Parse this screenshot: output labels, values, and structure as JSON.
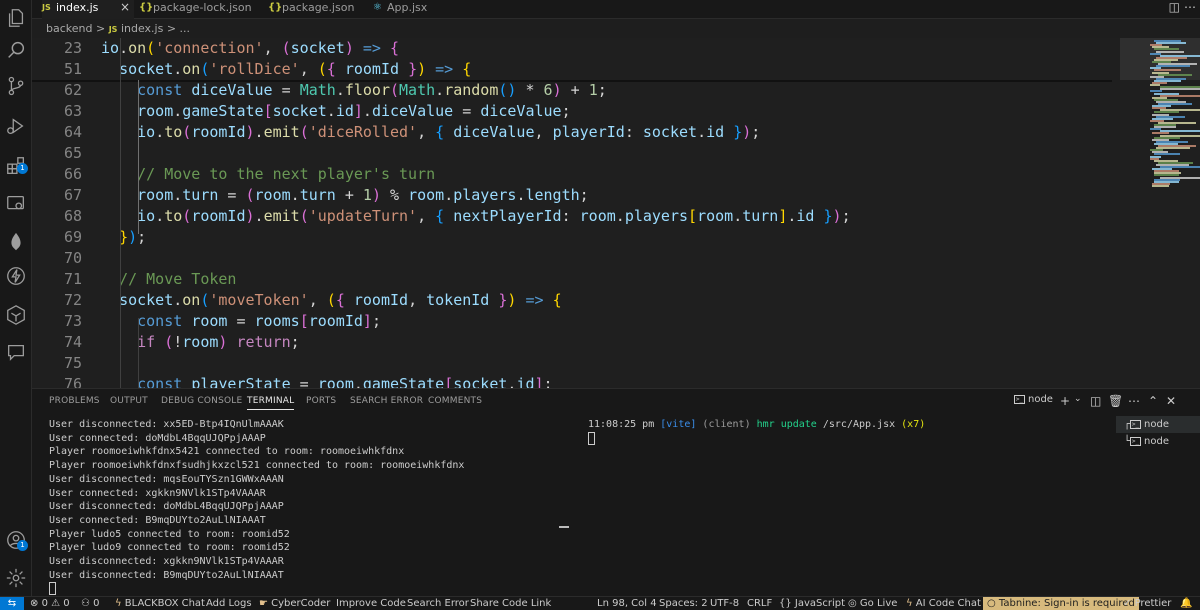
{
  "tabs": [
    {
      "icon": "JS",
      "label": "index.js",
      "active": true
    },
    {
      "icon": "{}",
      "label": "package-lock.json"
    },
    {
      "icon": "{}",
      "label": "package.json"
    },
    {
      "icon": "⚛",
      "label": "App.jsx"
    }
  ],
  "tab_close": "×",
  "breadcrumb": {
    "folder": "backend",
    "sep": ">",
    "file_icon": "JS",
    "file": "index.js",
    "tail": "> ..."
  },
  "editor": {
    "line_numbers": [
      "23",
      "51",
      "62",
      "63",
      "64",
      "65",
      "66",
      "67",
      "68",
      "69",
      "70",
      "71",
      "72",
      "73",
      "74",
      "75",
      "76"
    ],
    "lines": [
      [
        [
          "t-var",
          "io"
        ],
        [
          "t-op",
          "."
        ],
        [
          "t-fn",
          "on"
        ],
        [
          "t-b1",
          "("
        ],
        [
          "t-str",
          "'connection'"
        ],
        [
          "t-op",
          ", "
        ],
        [
          "t-b2",
          "("
        ],
        [
          "t-var",
          "socket"
        ],
        [
          "t-b2",
          ")"
        ],
        [
          "t-op",
          " "
        ],
        [
          "t-kw",
          "=>"
        ],
        [
          "t-op",
          " "
        ],
        [
          "t-b2",
          "{"
        ]
      ],
      [
        [
          "t-op",
          "  "
        ],
        [
          "t-var",
          "socket"
        ],
        [
          "t-op",
          "."
        ],
        [
          "t-fn",
          "on"
        ],
        [
          "t-b3",
          "("
        ],
        [
          "t-str",
          "'rollDice'"
        ],
        [
          "t-op",
          ", "
        ],
        [
          "t-b1",
          "("
        ],
        [
          "t-b2",
          "{"
        ],
        [
          "t-op",
          " "
        ],
        [
          "t-var",
          "roomId"
        ],
        [
          "t-op",
          " "
        ],
        [
          "t-b2",
          "}"
        ],
        [
          "t-b1",
          ")"
        ],
        [
          "t-op",
          " "
        ],
        [
          "t-kw",
          "=>"
        ],
        [
          "t-op",
          " "
        ],
        [
          "t-b1",
          "{"
        ]
      ],
      [
        [
          "t-op",
          "    "
        ],
        [
          "t-kw",
          "const"
        ],
        [
          "t-op",
          " "
        ],
        [
          "t-var",
          "diceValue"
        ],
        [
          "t-op",
          " = "
        ],
        [
          "t-cls",
          "Math"
        ],
        [
          "t-op",
          "."
        ],
        [
          "t-fn",
          "floor"
        ],
        [
          "t-b2",
          "("
        ],
        [
          "t-cls",
          "Math"
        ],
        [
          "t-op",
          "."
        ],
        [
          "t-fn",
          "random"
        ],
        [
          "t-b3",
          "()"
        ],
        [
          "t-op",
          " * "
        ],
        [
          "t-num",
          "6"
        ],
        [
          "t-b2",
          ")"
        ],
        [
          "t-op",
          " + "
        ],
        [
          "t-num",
          "1"
        ],
        [
          "t-op",
          ";"
        ]
      ],
      [
        [
          "t-op",
          "    "
        ],
        [
          "t-var",
          "room"
        ],
        [
          "t-op",
          "."
        ],
        [
          "t-var",
          "gameState"
        ],
        [
          "t-b2",
          "["
        ],
        [
          "t-var",
          "socket"
        ],
        [
          "t-op",
          "."
        ],
        [
          "t-var",
          "id"
        ],
        [
          "t-b2",
          "]"
        ],
        [
          "t-op",
          "."
        ],
        [
          "t-var",
          "diceValue"
        ],
        [
          "t-op",
          " = "
        ],
        [
          "t-var",
          "diceValue"
        ],
        [
          "t-op",
          ";"
        ]
      ],
      [
        [
          "t-op",
          "    "
        ],
        [
          "t-var",
          "io"
        ],
        [
          "t-op",
          "."
        ],
        [
          "t-fn",
          "to"
        ],
        [
          "t-b2",
          "("
        ],
        [
          "t-var",
          "roomId"
        ],
        [
          "t-b2",
          ")"
        ],
        [
          "t-op",
          "."
        ],
        [
          "t-fn",
          "emit"
        ],
        [
          "t-b2",
          "("
        ],
        [
          "t-str",
          "'diceRolled'"
        ],
        [
          "t-op",
          ", "
        ],
        [
          "t-b3",
          "{"
        ],
        [
          "t-op",
          " "
        ],
        [
          "t-var",
          "diceValue"
        ],
        [
          "t-op",
          ", "
        ],
        [
          "t-var",
          "playerId"
        ],
        [
          "t-op",
          ": "
        ],
        [
          "t-var",
          "socket"
        ],
        [
          "t-op",
          "."
        ],
        [
          "t-var",
          "id"
        ],
        [
          "t-op",
          " "
        ],
        [
          "t-b3",
          "}"
        ],
        [
          "t-b2",
          ")"
        ],
        [
          "t-op",
          ";"
        ]
      ],
      [],
      [
        [
          "t-op",
          "    "
        ],
        [
          "t-cm",
          "// Move to the next player's turn"
        ]
      ],
      [
        [
          "t-op",
          "    "
        ],
        [
          "t-var",
          "room"
        ],
        [
          "t-op",
          "."
        ],
        [
          "t-var",
          "turn"
        ],
        [
          "t-op",
          " = "
        ],
        [
          "t-b2",
          "("
        ],
        [
          "t-var",
          "room"
        ],
        [
          "t-op",
          "."
        ],
        [
          "t-var",
          "turn"
        ],
        [
          "t-op",
          " + "
        ],
        [
          "t-num",
          "1"
        ],
        [
          "t-b2",
          ")"
        ],
        [
          "t-op",
          " % "
        ],
        [
          "t-var",
          "room"
        ],
        [
          "t-op",
          "."
        ],
        [
          "t-var",
          "players"
        ],
        [
          "t-op",
          "."
        ],
        [
          "t-var",
          "length"
        ],
        [
          "t-op",
          ";"
        ]
      ],
      [
        [
          "t-op",
          "    "
        ],
        [
          "t-var",
          "io"
        ],
        [
          "t-op",
          "."
        ],
        [
          "t-fn",
          "to"
        ],
        [
          "t-b2",
          "("
        ],
        [
          "t-var",
          "roomId"
        ],
        [
          "t-b2",
          ")"
        ],
        [
          "t-op",
          "."
        ],
        [
          "t-fn",
          "emit"
        ],
        [
          "t-b2",
          "("
        ],
        [
          "t-str",
          "'updateTurn'"
        ],
        [
          "t-op",
          ", "
        ],
        [
          "t-b3",
          "{"
        ],
        [
          "t-op",
          " "
        ],
        [
          "t-var",
          "nextPlayerId"
        ],
        [
          "t-op",
          ": "
        ],
        [
          "t-var",
          "room"
        ],
        [
          "t-op",
          "."
        ],
        [
          "t-var",
          "players"
        ],
        [
          "t-b1",
          "["
        ],
        [
          "t-var",
          "room"
        ],
        [
          "t-op",
          "."
        ],
        [
          "t-var",
          "turn"
        ],
        [
          "t-b1",
          "]"
        ],
        [
          "t-op",
          "."
        ],
        [
          "t-var",
          "id"
        ],
        [
          "t-op",
          " "
        ],
        [
          "t-b3",
          "}"
        ],
        [
          "t-b2",
          ")"
        ],
        [
          "t-op",
          ";"
        ]
      ],
      [
        [
          "t-op",
          "  "
        ],
        [
          "t-b1",
          "}"
        ],
        [
          "t-b3",
          ")"
        ],
        [
          "t-op",
          ";"
        ]
      ],
      [],
      [
        [
          "t-op",
          "  "
        ],
        [
          "t-cm",
          "// Move Token"
        ]
      ],
      [
        [
          "t-op",
          "  "
        ],
        [
          "t-var",
          "socket"
        ],
        [
          "t-op",
          "."
        ],
        [
          "t-fn",
          "on"
        ],
        [
          "t-b3",
          "("
        ],
        [
          "t-str",
          "'moveToken'"
        ],
        [
          "t-op",
          ", "
        ],
        [
          "t-b1",
          "("
        ],
        [
          "t-b2",
          "{"
        ],
        [
          "t-op",
          " "
        ],
        [
          "t-var",
          "roomId"
        ],
        [
          "t-op",
          ", "
        ],
        [
          "t-var",
          "tokenId"
        ],
        [
          "t-op",
          " "
        ],
        [
          "t-b2",
          "}"
        ],
        [
          "t-b1",
          ")"
        ],
        [
          "t-op",
          " "
        ],
        [
          "t-kw",
          "=>"
        ],
        [
          "t-op",
          " "
        ],
        [
          "t-b1",
          "{"
        ]
      ],
      [
        [
          "t-op",
          "    "
        ],
        [
          "t-kw",
          "const"
        ],
        [
          "t-op",
          " "
        ],
        [
          "t-var",
          "room"
        ],
        [
          "t-op",
          " = "
        ],
        [
          "t-var",
          "rooms"
        ],
        [
          "t-b2",
          "["
        ],
        [
          "t-var",
          "roomId"
        ],
        [
          "t-b2",
          "]"
        ],
        [
          "t-op",
          ";"
        ]
      ],
      [
        [
          "t-op",
          "    "
        ],
        [
          "t-ctl",
          "if"
        ],
        [
          "t-op",
          " "
        ],
        [
          "t-b2",
          "("
        ],
        [
          "t-op",
          "!"
        ],
        [
          "t-var",
          "room"
        ],
        [
          "t-b2",
          ")"
        ],
        [
          "t-op",
          " "
        ],
        [
          "t-ctl",
          "return"
        ],
        [
          "t-op",
          ";"
        ]
      ],
      [],
      [
        [
          "t-op",
          "    "
        ],
        [
          "t-kw",
          "const"
        ],
        [
          "t-op",
          " "
        ],
        [
          "t-var",
          "playerState"
        ],
        [
          "t-op",
          " = "
        ],
        [
          "t-var",
          "room"
        ],
        [
          "t-op",
          "."
        ],
        [
          "t-var",
          "gameState"
        ],
        [
          "t-b2",
          "["
        ],
        [
          "t-var",
          "socket"
        ],
        [
          "t-op",
          "."
        ],
        [
          "t-var",
          "id"
        ],
        [
          "t-b2",
          "]"
        ],
        [
          "t-op",
          ";"
        ]
      ]
    ]
  },
  "panel": {
    "tabs": [
      "PROBLEMS",
      "OUTPUT",
      "DEBUG CONSOLE",
      "TERMINAL",
      "PORTS",
      "SEARCH ERROR",
      "COMMENTS"
    ],
    "active_tab": "TERMINAL",
    "terminal_name": "node",
    "terminal_left": [
      "User disconnected: xx5ED-Btp4IQnUlmAAAK",
      "User connected: doMdbL4BqqUJQPpjAAAP",
      "Player roomoeiwhkfdnx5421 connected to room: roomoeiwhkfdnx",
      "Player roomoeiwhkfdnxfsudhjkxzcl521 connected to room: roomoeiwhkfdnx",
      "User disconnected: mqsEouTYSzn1GWWxAAAN",
      "User connected: xgkkn9NVlk1STp4VAAAR",
      "User disconnected: doMdbL4BqqUJQPpjAAAP",
      "User connected: B9mqDUYto2AuLlNIAAAT",
      "Player ludo5 connected to room: roomid52",
      "Player ludo9 connected to room: roomid52",
      "User disconnected: xgkkn9NVlk1STp4VAAAR",
      "User disconnected: B9mqDUYto2AuLlNIAAAT"
    ],
    "terminal_right": {
      "time": "11:08:25 pm",
      "tag": "[vite]",
      "client": "(client)",
      "msg": "hmr update",
      "path": "/src/App.jsx",
      "count": "(x7)"
    },
    "terminal_list": [
      "node",
      "node"
    ]
  },
  "status": {
    "errors": "0",
    "warnings": "0",
    "ports": "0",
    "blackbox": "BLACKBOX Chat",
    "add_logs": "Add Logs",
    "cybercoder": "CyberCoder",
    "improve": "Improve Code",
    "search_error": "Search Error",
    "share": "Share Code Link",
    "position": "Ln 98, Col 4",
    "spaces": "Spaces: 2",
    "encoding": "UTF-8",
    "eol": "CRLF",
    "language": "JavaScript",
    "golive": "Go Live",
    "aichat": "AI Code Chat",
    "tabnine": "Tabnine: Sign-in is required",
    "prettier": "Prettier"
  },
  "colors": {
    "accent": "#0078d4",
    "tabnine_bg": "#d7ba7d"
  },
  "icons": [
    "explorer-icon",
    "search-icon",
    "source-control-icon",
    "run-debug-icon",
    "extensions-icon",
    "remote-explorer-icon",
    "mongodb-icon",
    "thunder-client-icon",
    "docker-icon",
    "comments-icon",
    "account-icon",
    "settings-icon"
  ]
}
